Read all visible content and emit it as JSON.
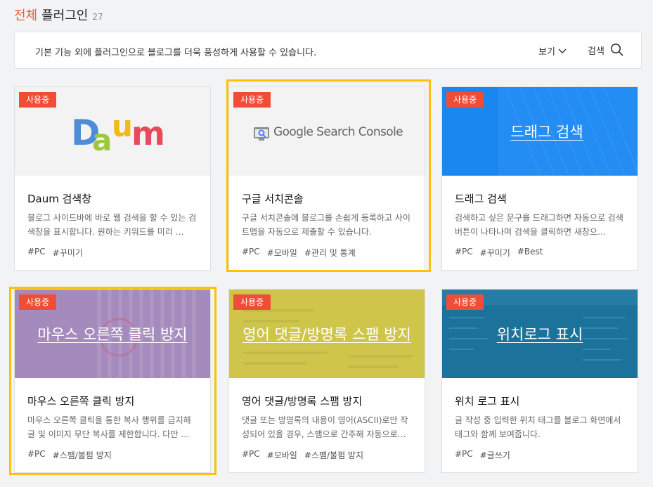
{
  "header": {
    "title_accent": "전체",
    "title_main": "플러그인",
    "count": "27"
  },
  "description_bar": {
    "text": "기본 기능 외에 플러그인으로 블로그를 더욱 풍성하게 사용할 수 있습니다.",
    "view_label": "보기",
    "search_label": "검색"
  },
  "status_badge": "사용중",
  "cards": [
    {
      "name": "Daum 검색창",
      "desc": "블로그 사이드바에 바로 웹 검색을 할 수 있는 검색창을 표시합니다. 원하는 키워드를 미리 …",
      "tags": [
        "#PC",
        "#꾸미기"
      ],
      "logo_letters": [
        "D",
        "a",
        "u",
        "m"
      ],
      "thumb_title": ""
    },
    {
      "name": "구글 서치콘솔",
      "desc": "구글 서치콘솔에 블로그를 손쉽게 등록하고 사이트맵을 자동으로 제출할 수 있습니다.",
      "tags": [
        "#PC",
        "#모바일",
        "#관리 및 통계"
      ],
      "logo_text": "Google Search Console",
      "thumb_title": ""
    },
    {
      "name": "드래그 검색",
      "desc": "검색하고 싶은 문구를 드래그하면 자동으로 검색 버튼이 나타나며 검색을 클릭하면 새창으…",
      "tags": [
        "#PC",
        "#꾸미기",
        "#Best"
      ],
      "thumb_title": "드래그 검색"
    },
    {
      "name": "마우스 오른쪽 클릭 방지",
      "desc": "마우스 오른쪽 클릭을 통한 복사 행위를 금지해 글 및 이미지 무단 복사를 제한합니다. 다만 …",
      "tags": [
        "#PC",
        "#스팸/불펌 방지"
      ],
      "thumb_title": "마우스 오른쪽 클릭 방지"
    },
    {
      "name": "영어 댓글/방명록 스팸 방지",
      "desc": "댓글 또는 방명록의 내용이 영어(ASCII)로만 작성되어 있을 경우, 스팸으로 간주해 자동으로…",
      "tags": [
        "#PC",
        "#모바일",
        "#스팸/불펌 방지"
      ],
      "thumb_title": "영어 댓글/방명록 스팸 방지"
    },
    {
      "name": "위치 로그 표시",
      "desc": "글 작성 중 입력한 위치 태그를 블로그 화면에서 태그와 함께 보여줍니다.",
      "tags": [
        "#PC",
        "#글쓰기"
      ],
      "thumb_title": "위치로그 표시"
    }
  ],
  "colors": {
    "accent": "#ef5a3c",
    "badge": "#ef4d35",
    "highlight": "#ffc107",
    "drag_bg": "#1a86f0",
    "mouse_bg": "#a58bbd",
    "spam_bg": "#cfc54a",
    "location_bg": "#1b739c"
  }
}
